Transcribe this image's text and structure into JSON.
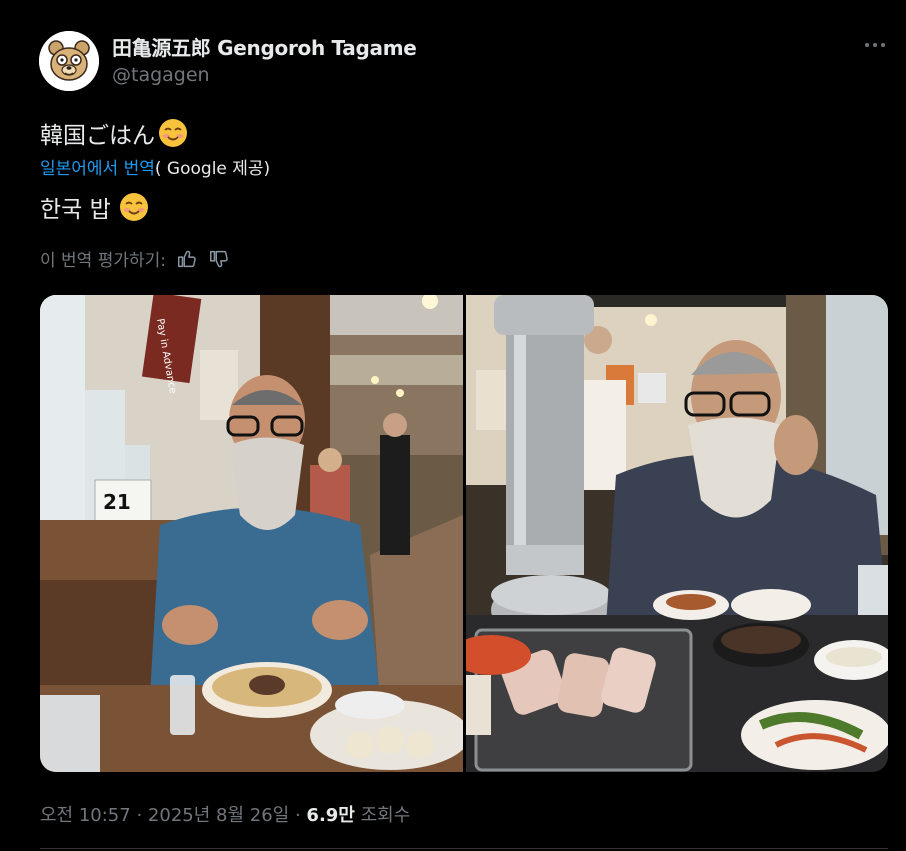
{
  "author": {
    "display_name": "田亀源五郎 Gengoroh Tagame",
    "handle": "@tagagen",
    "avatar_icon": "bear-cartoon-avatar"
  },
  "tweet": {
    "original_text": "韓国ごはん",
    "translation_link_text": "일본어에서 번역",
    "translation_provider_text": "( Google 제공)",
    "translated_text": "한국 밥",
    "emoji_icon": "smiling-face-emoji",
    "rate_translation_label": "이 번역 평가하기:"
  },
  "media": {
    "photo_count": 2,
    "photo1_table_number": "21",
    "photo1_sign_text": "Pay in Advance"
  },
  "meta": {
    "time": "오전 10:57",
    "date": "2025년 8월 26일",
    "views_count": "6.9만",
    "views_label": "조회수",
    "separator": "·"
  },
  "colors": {
    "background": "#000000",
    "text_primary": "#e7e9ea",
    "text_secondary": "#71767b",
    "link": "#1d9bf0",
    "divider": "#2f3336"
  }
}
